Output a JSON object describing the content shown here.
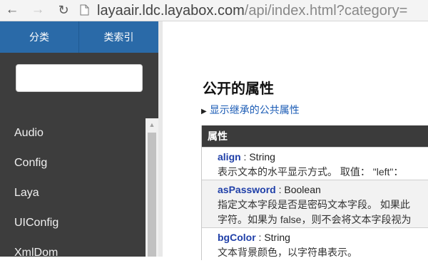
{
  "browser": {
    "url_host": "layaair.ldc.layabox.com",
    "url_path": "/api/index.html?category="
  },
  "sidebar": {
    "tabs": [
      "分类",
      "类索引"
    ],
    "search": {
      "placeholder": ""
    },
    "classes": [
      "Audio",
      "Config",
      "Laya",
      "UIConfig",
      "XmlDom"
    ]
  },
  "content": {
    "heading": "公开的属性",
    "inherit_link": "显示继承的公共属性",
    "table_header": "属性",
    "properties": [
      {
        "name": "align",
        "type": " : String",
        "desc": [
          "表示文本的水平显示方式。 取值： \"left\"："
        ]
      },
      {
        "name": "asPassword",
        "type": " : Boolean",
        "desc": [
          "指定文本字段是否是密码文本字段。 如果此",
          "字符。如果为 false，则不会将文本字段视为"
        ]
      },
      {
        "name": "bgColor",
        "type": " : String",
        "desc": [
          "文本背景颜色，以字符串表示。"
        ]
      }
    ]
  },
  "colors": {
    "tab_bar": "#2a6aa8",
    "sidebar": "#3d3d3d",
    "link": "#1a5bb5",
    "prop_name": "#1f3fa8",
    "table_header": "#3b3b3b"
  }
}
